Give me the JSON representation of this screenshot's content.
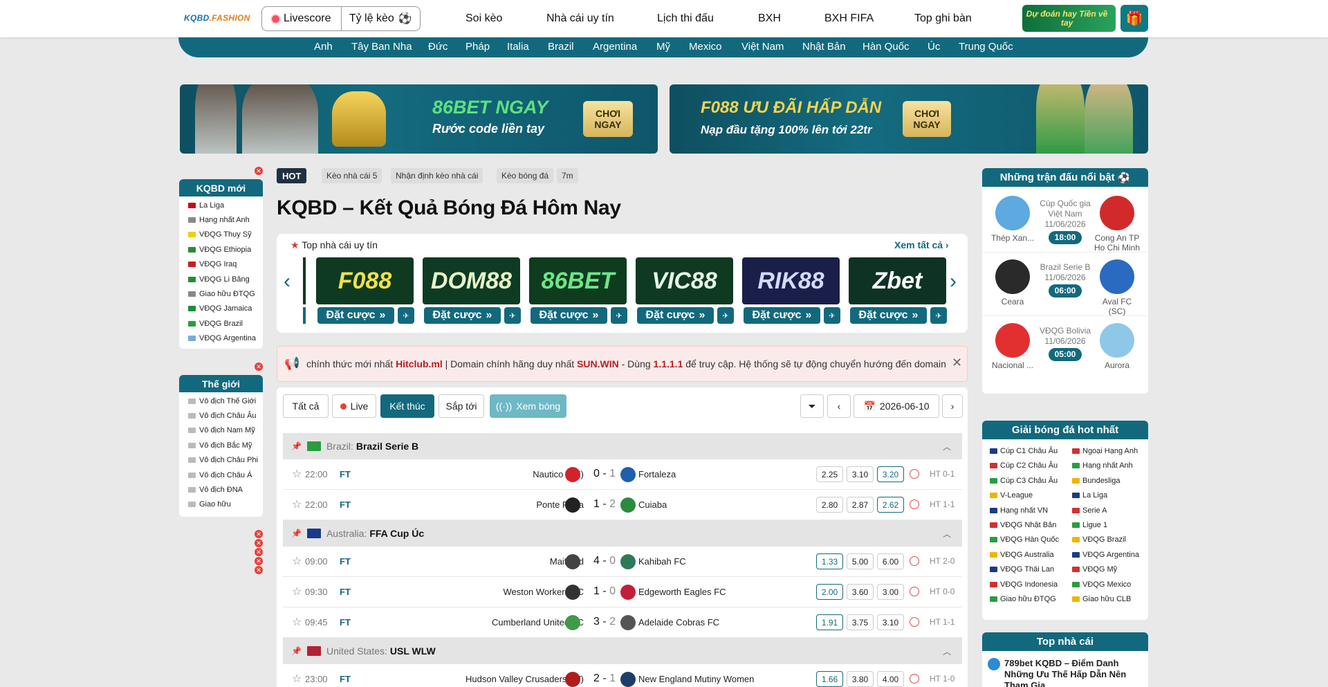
{
  "header": {
    "logo_main": "KQBD",
    "logo_ext": ".FASHION",
    "livescore": "Livescore",
    "tyle": "Tỷ lệ kèo",
    "nav": [
      "Soi kèo",
      "Nhà cái uy tín",
      "Lịch thi đấu",
      "BXH",
      "BXH FIFA",
      "Top ghi bàn"
    ],
    "promo": "Dự đoán hay Tiền về tay"
  },
  "leagues": [
    "Anh",
    "Tây Ban Nha",
    "Đức",
    "Pháp",
    "Italia",
    "Brazil",
    "Argentina",
    "Mỹ",
    "Mexico",
    "Việt Nam",
    "Nhật Bản",
    "Hàn Quốc",
    "Úc",
    "Trung Quốc"
  ],
  "banners": [
    {
      "title": "86BET NGAY",
      "sub": "Rước code liền tay",
      "btn": "CHƠI NGAY"
    },
    {
      "title": "F088 ƯU ĐÃI HẤP DẪN",
      "sub": "Nạp đầu tặng 100% lên tới 22tr",
      "btn": "CHƠI NGAY"
    }
  ],
  "left_new": {
    "title": "KQBD mới",
    "items": [
      "La Liga",
      "Hạng nhất Anh",
      "VĐQG Thụy Sỹ",
      "VĐQG Ethiopia",
      "VĐQG Iraq",
      "VĐQG Li Băng",
      "Giao hữu ĐTQG",
      "VĐQG Jamaica",
      "VĐQG Brazil",
      "VĐQG Argentina"
    ]
  },
  "left_world": {
    "title": "Thế giới",
    "items": [
      "Vô địch Thế Giới",
      "Vô địch Châu Âu",
      "Vô địch Nam Mỹ",
      "Vô địch Bắc Mỹ",
      "Vô địch Châu Phi",
      "Vô địch Châu Á",
      "Vô địch ĐNA",
      "Giao hữu"
    ]
  },
  "tags": {
    "hot": "HOT",
    "items": [
      "Kèo nhà cái 5",
      "Nhận định kèo nhà cái",
      "Kèo bóng đá",
      "7m"
    ]
  },
  "page_title": "KQBD – Kết Quả Bóng Đá Hôm Nay",
  "topbook": {
    "title": "Top nhà cái uy tín",
    "see_all": "Xem tất cả",
    "bet_label": "Đặt cược",
    "brands": [
      "F088",
      "DOM88",
      "86BET",
      "VIC88",
      "RIK88",
      "Zbet"
    ]
  },
  "notice": {
    "t1": "chính thức mới nhất ",
    "b1": "Hitclub.ml",
    "t2": " | Domain chính hãng duy nhất ",
    "b2": "SUN.WIN",
    "t3": " - Dùng ",
    "b3": "1.1.1.1",
    "t4": " để truy cập. Hệ thống sẽ tự động chuyển hướng đến domain"
  },
  "filters": {
    "all": "Tất cả",
    "live": "Live",
    "finished": "Kết thúc",
    "upcoming": "Sắp tới",
    "watch": "Xem bóng",
    "date": "2026-06-10"
  },
  "groups": [
    {
      "country": "Brazil:",
      "league": "Brazil Serie B",
      "matches": [
        {
          "time": "22:00",
          "status": "FT",
          "home": "Nautico (PE)",
          "hs": "0",
          "as": "1",
          "away": "Fortaleza",
          "odds": [
            "2.25",
            "3.10",
            "3.20"
          ],
          "hl": 2,
          "ht": "HT 0-1"
        },
        {
          "time": "22:00",
          "status": "FT",
          "home": "Ponte Preta",
          "hs": "1",
          "as": "2",
          "away": "Cuiaba",
          "odds": [
            "2.80",
            "2.87",
            "2.62"
          ],
          "hl": 2,
          "ht": "HT 1-1"
        }
      ]
    },
    {
      "country": "Australia:",
      "league": "FFA Cup Úc",
      "matches": [
        {
          "time": "09:00",
          "status": "FT",
          "home": "Maitland",
          "hs": "4",
          "as": "0",
          "away": "Kahibah FC",
          "odds": [
            "1.33",
            "5.00",
            "6.00"
          ],
          "hl": 0,
          "ht": "HT 2-0"
        },
        {
          "time": "09:30",
          "status": "FT",
          "home": "Weston Workers FC",
          "hs": "1",
          "as": "0",
          "away": "Edgeworth Eagles FC",
          "odds": [
            "2.00",
            "3.60",
            "3.00"
          ],
          "hl": 0,
          "ht": "HT 0-0"
        },
        {
          "time": "09:45",
          "status": "FT",
          "home": "Cumberland United FC",
          "hs": "3",
          "as": "2",
          "away": "Adelaide Cobras FC",
          "odds": [
            "1.91",
            "3.75",
            "3.10"
          ],
          "hl": 0,
          "ht": "HT 1-1"
        }
      ]
    },
    {
      "country": "United States:",
      "league": "USL WLW",
      "matches": [
        {
          "time": "23:00",
          "status": "FT",
          "home": "Hudson Valley Crusaders (W)",
          "hs": "2",
          "as": "1",
          "away": "New England Mutiny Women",
          "odds": [
            "1.66",
            "3.80",
            "4.00"
          ],
          "hl": 0,
          "ht": "HT 1-0"
        }
      ]
    }
  ],
  "featured": {
    "title": "Những trận đấu nổi bật",
    "matches": [
      {
        "home": "Thép Xan...",
        "league": "Cúp Quốc gia Việt Nam",
        "date": "11/06/2026",
        "time": "18:00",
        "away": "Cong An TP Ho Chi Minh"
      },
      {
        "home": "Ceara",
        "league": "Brazil Serie B",
        "date": "11/06/2026",
        "time": "06:00",
        "away": "Aval FC (SC)"
      },
      {
        "home": "Nacional ...",
        "league": "VĐQG Bolivia",
        "date": "11/06/2026",
        "time": "05:00",
        "away": "Aurora"
      }
    ]
  },
  "hot_leagues": {
    "title": "Giải bóng đá hot nhất",
    "left": [
      "Cúp C1 Châu Âu",
      "Cúp C2 Châu Âu",
      "Cúp C3 Châu Âu",
      "V-League",
      "Hạng nhất VN",
      "VĐQG Nhật Bản",
      "VĐQG Hàn Quốc",
      "VĐQG Australia",
      "VĐQG Thái Lan",
      "VĐQG Indonesia",
      "Giao hữu ĐTQG"
    ],
    "right": [
      "Ngoại Hạng Anh",
      "Hạng nhất Anh",
      "Bundesliga",
      "La Liga",
      "Serie A",
      "Ligue 1",
      "VĐQG Brazil",
      "VĐQG Argentina",
      "VĐQG Mỹ",
      "VĐQG Mexico",
      "Giao hữu CLB"
    ]
  },
  "top_bookies": {
    "title": "Top nhà cái",
    "first": "789bet KQBD – Điểm Danh Những Ưu Thế Hấp Dẫn Nên Tham Gia"
  }
}
